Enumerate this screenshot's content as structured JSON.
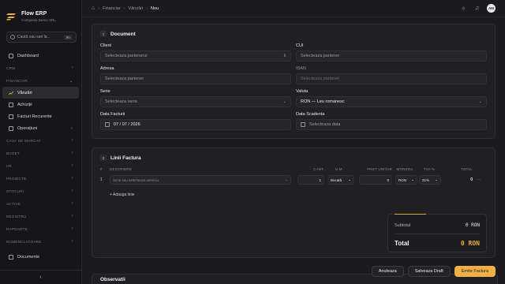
{
  "brand": {
    "name": "Flow ERP",
    "company": "Compania Demo SRL"
  },
  "search": {
    "placeholder": "Caută sau sari la...",
    "shortcut": "⌘K"
  },
  "sidebar": {
    "top": [
      {
        "label": "Dashboard",
        "icon": "grid-icon"
      }
    ],
    "sections": [
      {
        "label": "CRM"
      },
      {
        "label": "FINANCIAR"
      }
    ],
    "financiar_items": [
      {
        "label": "Vânzări",
        "icon": "trend-icon",
        "active": true
      },
      {
        "label": "Achiziții",
        "icon": "cart-icon"
      },
      {
        "label": "Facturi Recurente",
        "icon": "repeat-icon"
      },
      {
        "label": "Operațiuni",
        "icon": "link-icon"
      }
    ],
    "more_sections": [
      "CASA DE MARCAT",
      "BUGET",
      "HR",
      "PROIECTE",
      "STOCURI",
      "ACTIVE",
      "REGISTRU",
      "RAPOARTE",
      "NOMENCLATOARE"
    ],
    "bottom_item": {
      "label": "Documente",
      "icon": "folder-icon"
    },
    "collapse": "‹"
  },
  "breadcrumb": {
    "items": [
      "Financiar",
      "Vânzări"
    ],
    "current": "Nou"
  },
  "user": {
    "initials": "AM"
  },
  "document": {
    "num": "1",
    "title": "Document",
    "client_label": "Client",
    "client_ph": "Selecteaza partenerul",
    "cui_label": "CUI",
    "cui_ph": "Selecteaza partener",
    "adresa_label": "Adresa",
    "adresa_ph": "Selecteaza partener",
    "iban_label": "IBAN",
    "iban_ph": "Selecteaza partener",
    "serie_label": "Serie",
    "serie_ph": "Selecteaza seria",
    "valuta_label": "Valuta",
    "valuta_val": "RON — Leu romanesc",
    "data_label": "Data Facturii",
    "data_val": "07 / 07 / 2026",
    "scad_label": "Data Scadenta",
    "scad_ph": "Selecteaza data"
  },
  "lines": {
    "num": "2",
    "title": "Linii Factura",
    "headers": {
      "num": "#",
      "desc": "DESCRIERE",
      "qty": "CANT.",
      "um": "U.M.",
      "price": "PRET UNITAR",
      "cur": "MONEDA",
      "vat": "TVA %",
      "tot": "TOTAL"
    },
    "row": {
      "num": "1",
      "desc": "Scrie sau selecteaza serviciu",
      "qty": "1",
      "um": "Bucată",
      "price": "0",
      "cur": "RON",
      "vat": "21%",
      "tot": "0",
      "more": "···"
    },
    "add": "+ Adauga linie"
  },
  "totals": {
    "subtotal_label": "Subtotal",
    "subtotal_val": "0 RON",
    "total_label": "Total",
    "total_val": "0 RON"
  },
  "observatii": "Observatii",
  "actions": {
    "cancel": "Anuleaza",
    "draft": "Salveaza Draft",
    "emit": "Emite Factura"
  },
  "colors": {
    "accent": "#f0b045",
    "bg": "#1c1c1e"
  }
}
